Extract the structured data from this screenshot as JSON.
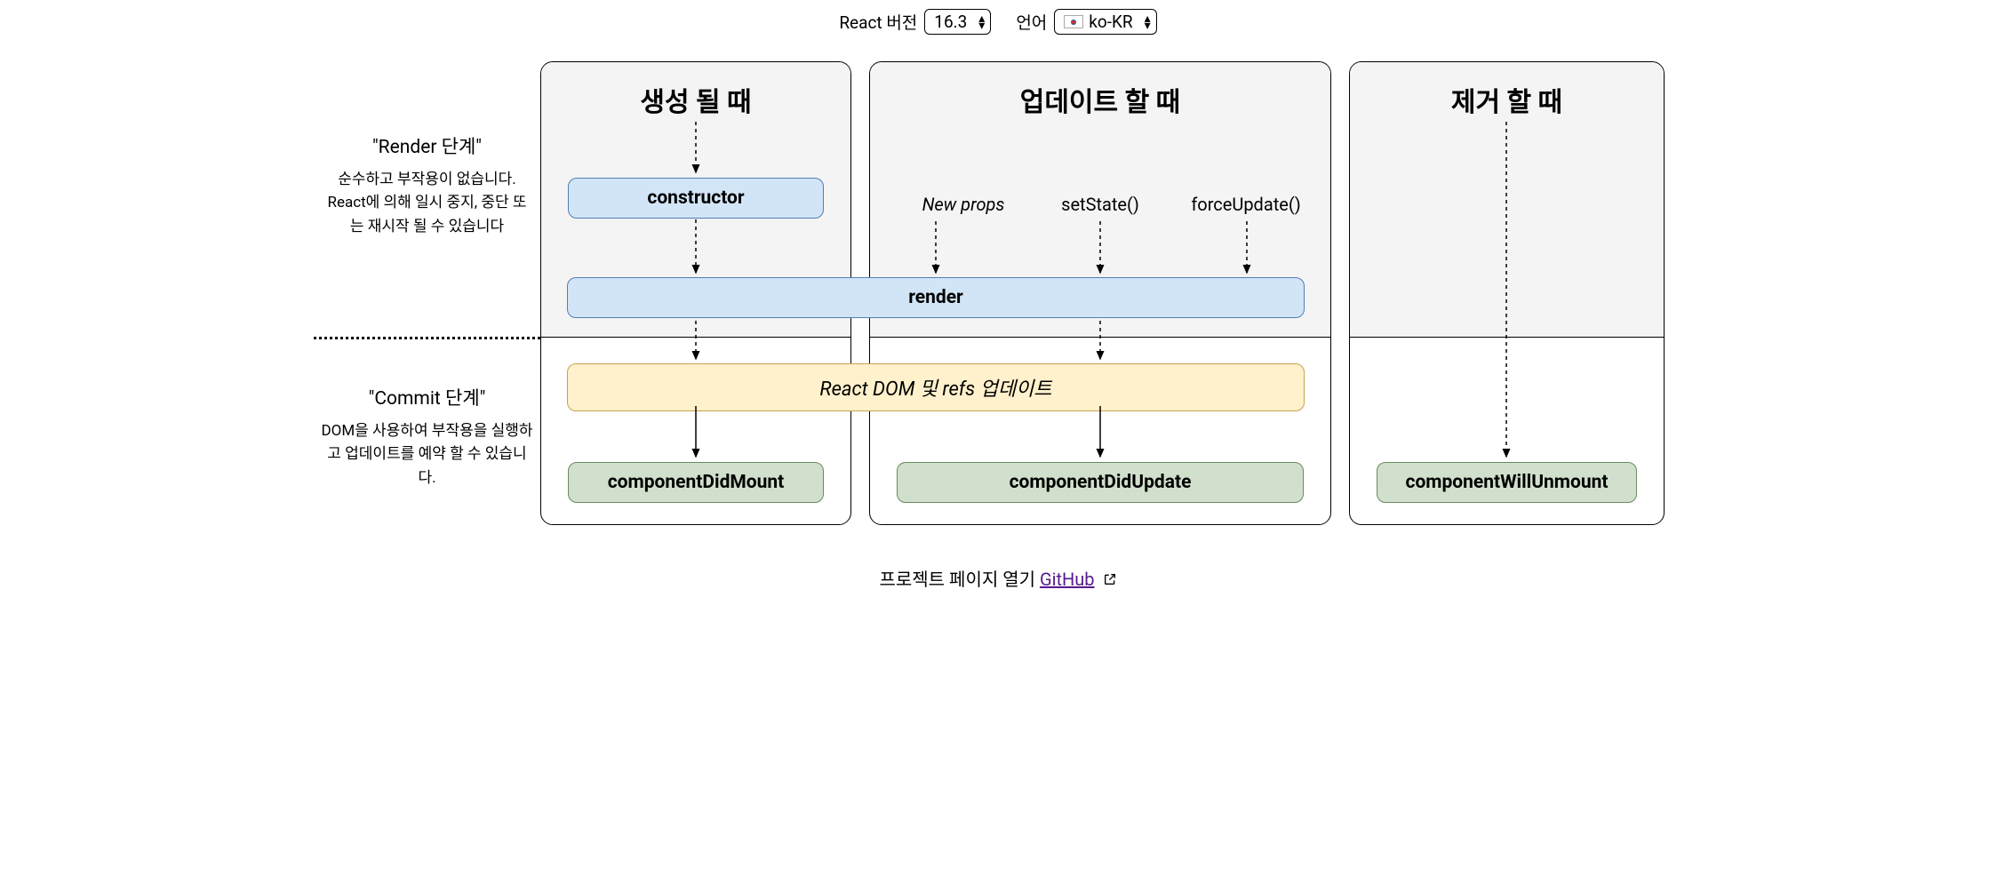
{
  "controls": {
    "version_label": "React 버전",
    "version_value": "16.3",
    "lang_label": "언어",
    "lang_value": "ko-KR"
  },
  "phases": {
    "render": {
      "title": "\"Render 단계\"",
      "desc": "순수하고 부작용이 없습니다. React에 의해 일시 중지, 중단 또는 재시작 될 수 있습니다"
    },
    "commit": {
      "title": "\"Commit 단계\"",
      "desc": "DOM을 사용하여 부작용을 실행하고 업데이트를 예약 할 수 있습니다."
    }
  },
  "columns": {
    "mount": {
      "title": "생성 될 때"
    },
    "update": {
      "title": "업데이트 할 때"
    },
    "unmount": {
      "title": "제거 할 때"
    }
  },
  "nodes": {
    "constructor": "constructor",
    "render": "render",
    "dom_refs": "React DOM 및 refs 업데이트",
    "did_mount": "componentDidMount",
    "did_update": "componentDidUpdate",
    "will_unmount": "componentWillUnmount"
  },
  "triggers": {
    "new_props": "New props",
    "set_state": "setState()",
    "force_update": "forceUpdate()"
  },
  "footer": {
    "prefix": "프로젝트 페이지 열기 ",
    "link": "GitHub"
  }
}
